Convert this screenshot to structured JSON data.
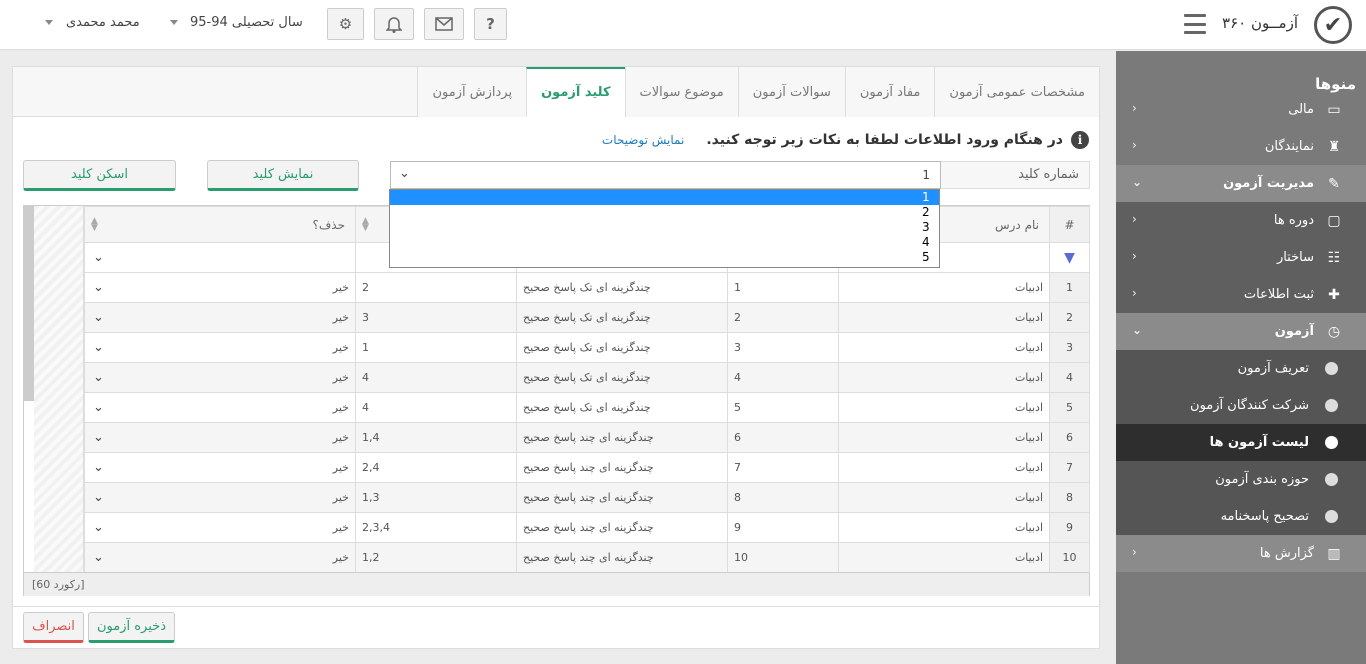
{
  "header": {
    "app_title": "آزمــون ۳۶۰",
    "year_label": "سال تحصیلی 94-95",
    "user_name": "محمد محمدی",
    "help_label": "?"
  },
  "sidebar": {
    "title": "منوها",
    "items": [
      {
        "label": "مالی",
        "icon": "credit-card-icon"
      },
      {
        "label": "نمایندگان",
        "icon": "agent-icon"
      },
      {
        "label": "مدیریت آزمون",
        "icon": "edit-icon"
      },
      {
        "label": "دوره ها",
        "icon": "folder-icon"
      },
      {
        "label": "ساختار",
        "icon": "sitemap-icon"
      },
      {
        "label": "ثبت اطلاعات",
        "icon": "user-plus-icon"
      },
      {
        "label": "آزمون",
        "icon": "clock-icon"
      },
      {
        "label": "تعریف آزمون"
      },
      {
        "label": "شرکت کنندگان آزمون"
      },
      {
        "label": "لیست آزمون ها"
      },
      {
        "label": "حوزه بندی آزمون"
      },
      {
        "label": "تصحیح پاسخنامه"
      },
      {
        "label": "گزارش ها",
        "icon": "bar-chart-icon"
      }
    ]
  },
  "tabs": [
    "مشخصات عمومی آزمون",
    "مفاد آزمون",
    "سوالات آزمون",
    "موضوع سوالات",
    "کلید آزمون",
    "پردازش آزمون"
  ],
  "info": {
    "text": "در هنگام ورود اطلاعات لطفا به نکات زیر توجه کنید.",
    "link": "نمایش توضیحات"
  },
  "form": {
    "key_label": "شماره کلید",
    "key_value": "1",
    "show_key_button": "نمایش کلید",
    "scan_key_button": "اسکن کلید",
    "options": [
      "1",
      "2",
      "3",
      "4",
      "5"
    ]
  },
  "grid": {
    "headers": {
      "num": "#",
      "lesson": "نام درس",
      "delete": "حذف؟"
    },
    "rows": [
      {
        "n": "1",
        "lesson": "ادبیات",
        "q": "1",
        "type": "چندگزینه ای تک پاسخ صحیح",
        "ans": "2",
        "del": "خیر"
      },
      {
        "n": "2",
        "lesson": "ادبیات",
        "q": "2",
        "type": "چندگزینه ای تک پاسخ صحیح",
        "ans": "3",
        "del": "خیر"
      },
      {
        "n": "3",
        "lesson": "ادبیات",
        "q": "3",
        "type": "چندگزینه ای تک پاسخ صحیح",
        "ans": "1",
        "del": "خیر"
      },
      {
        "n": "4",
        "lesson": "ادبیات",
        "q": "4",
        "type": "چندگزینه ای تک پاسخ صحیح",
        "ans": "4",
        "del": "خیر"
      },
      {
        "n": "5",
        "lesson": "ادبیات",
        "q": "5",
        "type": "چندگزینه ای تک پاسخ صحیح",
        "ans": "4",
        "del": "خیر"
      },
      {
        "n": "6",
        "lesson": "ادبیات",
        "q": "6",
        "type": "چندگزینه ای چند پاسخ صحیح",
        "ans": "1,4",
        "del": "خیر"
      },
      {
        "n": "7",
        "lesson": "ادبیات",
        "q": "7",
        "type": "چندگزینه ای چند پاسخ صحیح",
        "ans": "2,4",
        "del": "خیر"
      },
      {
        "n": "8",
        "lesson": "ادبیات",
        "q": "8",
        "type": "چندگزینه ای چند پاسخ صحیح",
        "ans": "1,3",
        "del": "خیر"
      },
      {
        "n": "9",
        "lesson": "ادبیات",
        "q": "9",
        "type": "چندگزینه ای چند پاسخ صحیح",
        "ans": "2,3,4",
        "del": "خیر"
      },
      {
        "n": "10",
        "lesson": "ادبیات",
        "q": "10",
        "type": "چندگزینه ای چند پاسخ صحیح",
        "ans": "1,2",
        "del": "خیر"
      }
    ],
    "footer": "[60 رکورد]"
  },
  "actions": {
    "save": "ذخیره آزمون",
    "cancel": "انصراف"
  }
}
